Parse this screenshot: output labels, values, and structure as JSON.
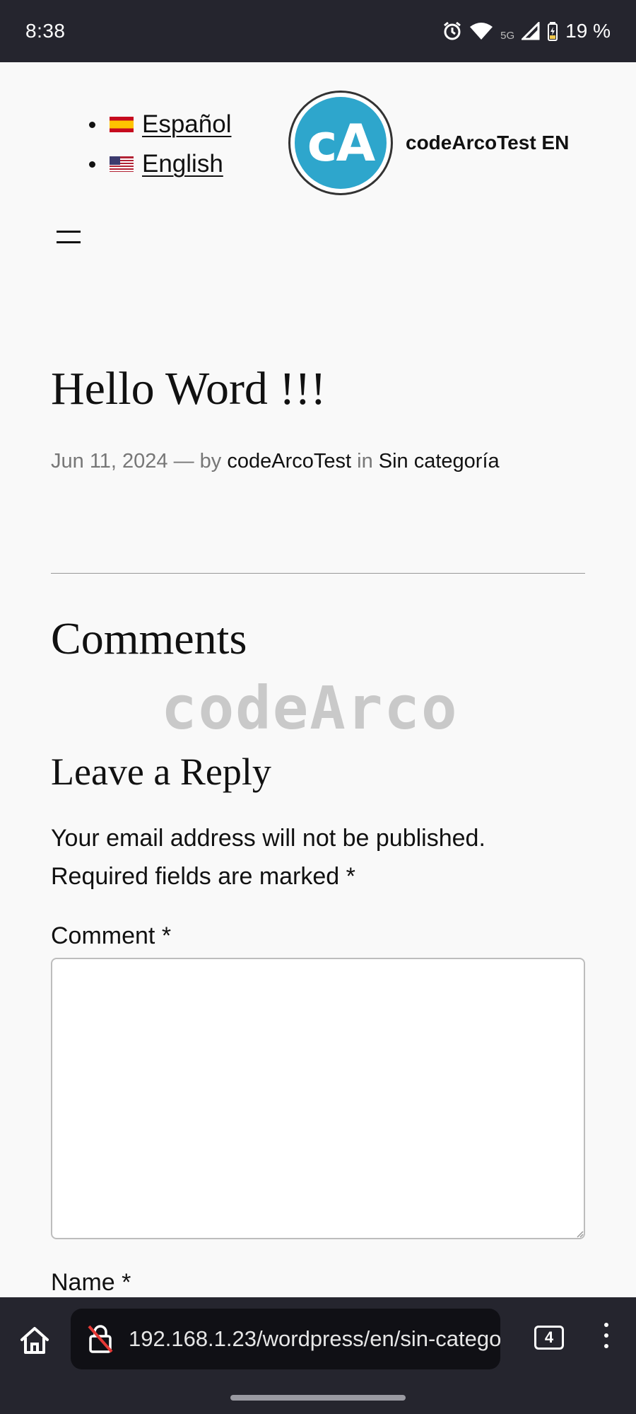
{
  "status_bar": {
    "time": "8:38",
    "battery": "19 %",
    "network": "5G",
    "icons": [
      "alarm-icon",
      "wifi-icon",
      "signal-icon",
      "battery-icon"
    ]
  },
  "header": {
    "languages": [
      {
        "label": "Español",
        "flag": "spain-flag-icon"
      },
      {
        "label": "English",
        "flag": "us-flag-icon"
      }
    ],
    "logo_text": "cA",
    "site_title": "codeArcoTest EN"
  },
  "post": {
    "title": "Hello Word !!!",
    "date": "Jun 11, 2024",
    "separator": "— by",
    "author": "codeArcoTest",
    "in_word": "in",
    "category": "Sin categoría"
  },
  "comments": {
    "heading": "Comments",
    "watermark": "codeArco",
    "reply_heading": "Leave a Reply",
    "notice": "Your email address will not be published. Required fields are marked *",
    "comment_label": "Comment *",
    "comment_value": "",
    "name_label": "Name *"
  },
  "browser": {
    "url": "192.168.1.23/wordpress/en/sin-catego",
    "tab_count": "4"
  },
  "colors": {
    "status_bar_bg": "#25252e",
    "page_bg": "#f9f9f9",
    "logo_blue": "#2ea6cc"
  }
}
